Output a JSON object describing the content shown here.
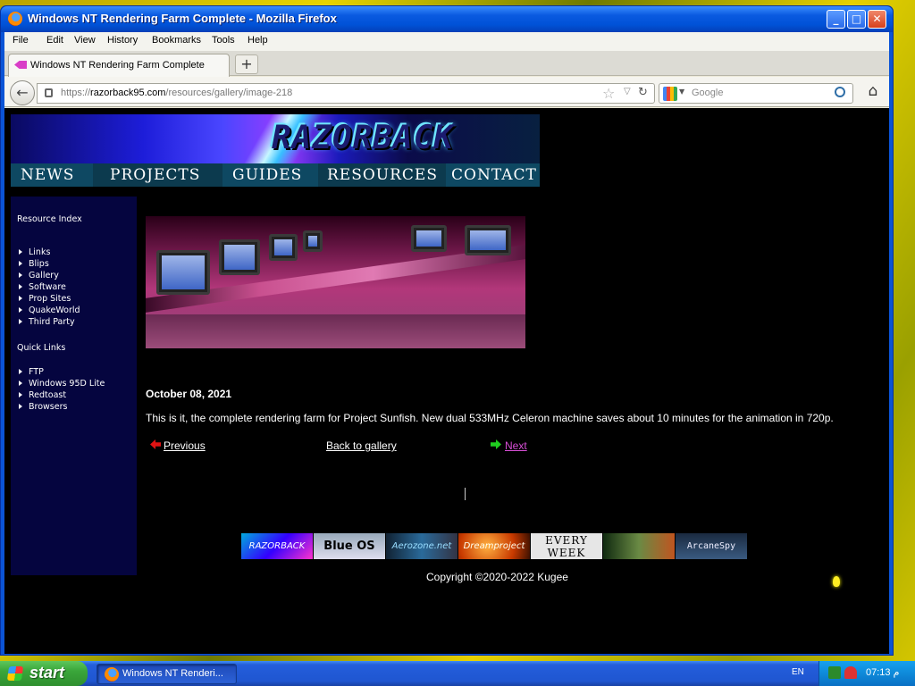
{
  "window": {
    "title": "Windows NT Rendering Farm Complete - Mozilla Firefox"
  },
  "menubar": [
    "File",
    "Edit",
    "View",
    "History",
    "Bookmarks",
    "Tools",
    "Help"
  ],
  "tab": {
    "title": "Windows NT Rendering Farm Complete",
    "newtab_symbol": "+"
  },
  "navbar": {
    "url_prefix": "https://",
    "url_domain": "razorback95.com",
    "url_path": "/resources/gallery/image-218",
    "search_placeholder": "Google"
  },
  "site": {
    "logo_text": "RAZORBACK",
    "nav": [
      "NEWS",
      "PROJECTS",
      "GUIDES",
      "RESOURCES",
      "CONTACT"
    ],
    "sidebar": {
      "resource_heading": "Resource Index",
      "resource_links": [
        "Links",
        "Blips",
        "Gallery",
        "Software",
        "Prop Sites",
        "QuakeWorld",
        "Third Party"
      ],
      "quick_heading": "Quick Links",
      "quick_links": [
        "FTP",
        "Windows 95D Lite",
        "Redtoast",
        "Browsers"
      ]
    },
    "post": {
      "date": "October 08, 2021",
      "body": "This is it, the complete rendering farm for Project Sunfish. New dual 533MHz Celeron machine saves about 10 minutes for the animation in 720p."
    },
    "pager": {
      "previous": "Previous",
      "back": "Back to gallery",
      "next": "Next"
    },
    "buttons": [
      "RAZORBACK",
      "Blue OS Museum",
      "Aerozone.net",
      "Dreamproject",
      "EVERY WEEK",
      "",
      "ArcaneSpy"
    ],
    "copyright": "Copyright ©2020-2022 Kugee"
  },
  "taskbar": {
    "start_label": "start",
    "task_label": "Windows NT Renderi...",
    "language": "EN",
    "clock": "07:13 م"
  }
}
